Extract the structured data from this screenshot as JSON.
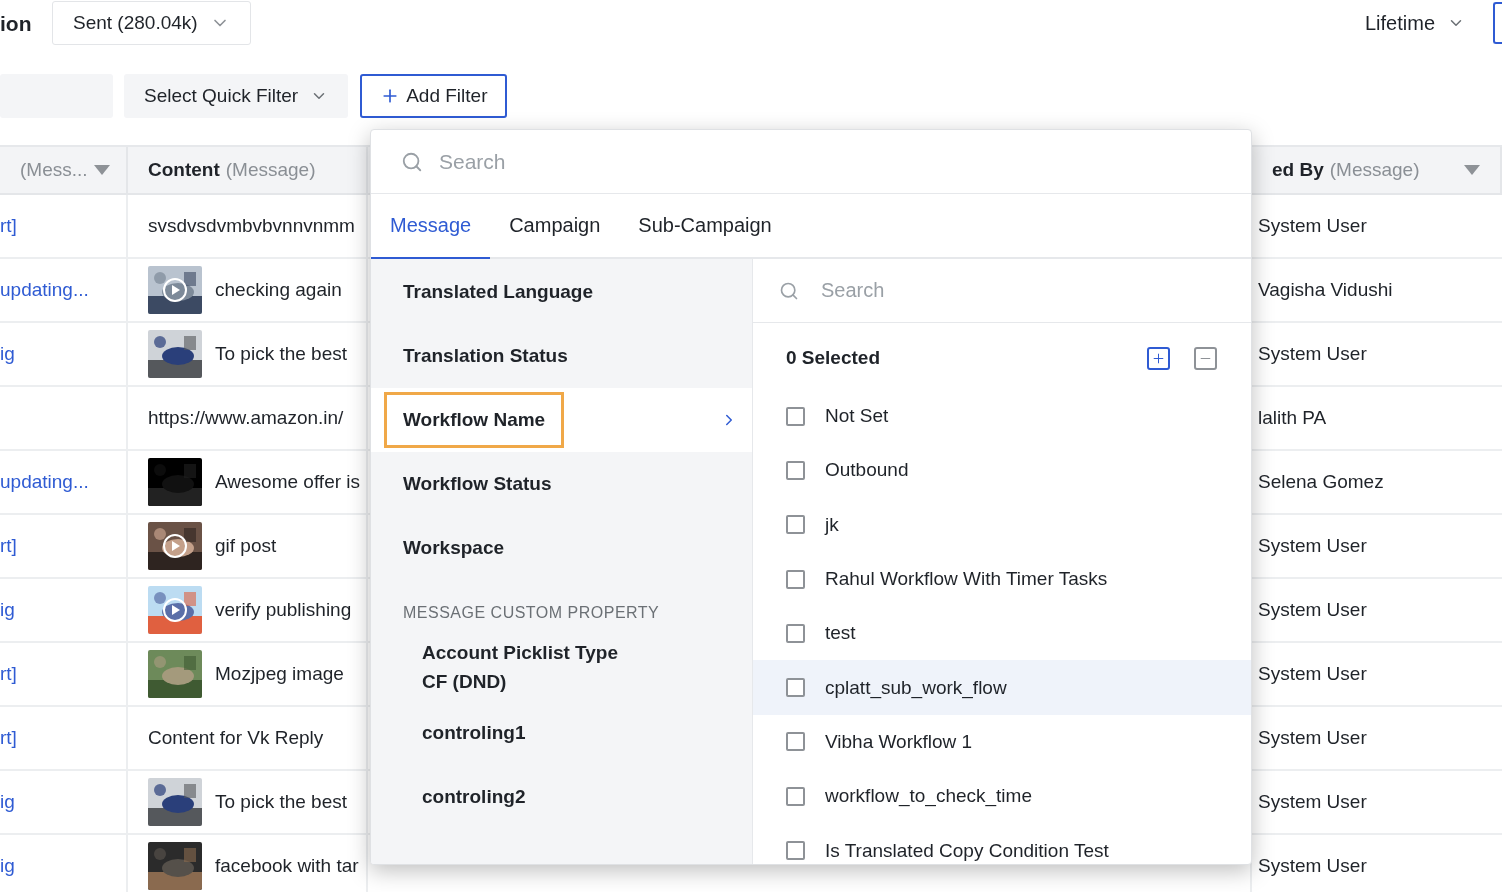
{
  "header": {
    "title": "ion",
    "status_dropdown": "Sent (280.04k)",
    "range_dropdown": "Lifetime"
  },
  "filter_bar": {
    "quick_filter": "Select Quick Filter",
    "add_filter": "Add Filter"
  },
  "table": {
    "columns": [
      {
        "source": "(Mess...",
        "menu": true
      },
      {
        "name": "Content",
        "source": "(Message)",
        "menu": false
      },
      {
        "name": "ed By",
        "source": "(Message)",
        "menu": true
      }
    ],
    "rows": [
      {
        "column_1": "rt]",
        "content": "svsdvsdvmbvbvnnvnmm",
        "by": "System User"
      },
      {
        "column_1": "updating...",
        "content": "checking again",
        "thumbnail": {
          "kind": "picture",
          "video": true
        },
        "by": "Vagisha Vidushi"
      },
      {
        "column_1": "ig",
        "content": "To pick the best",
        "thumbnail": {
          "kind": "picture",
          "video": false
        },
        "by": "System User"
      },
      {
        "content": "https://www.amazon.in/",
        "by": "lalith PA"
      },
      {
        "column_1": "updating...",
        "content": "Awesome offer is",
        "thumbnail": {
          "kind": "picture",
          "video": false
        },
        "by": "Selena Gomez"
      },
      {
        "column_1": "rt]",
        "content": "gif post",
        "thumbnail": {
          "kind": "picture",
          "video": true
        },
        "by": "System User"
      },
      {
        "column_1": "ig",
        "content": "verify publishing",
        "thumbnail": {
          "kind": "picture",
          "video": true
        },
        "by": "System User"
      },
      {
        "column_1": "rt]",
        "content": "Mozjpeg image",
        "thumbnail": {
          "kind": "picture",
          "video": false
        },
        "by": "System User"
      },
      {
        "column_1": "rt]",
        "content": "Content for Vk Reply",
        "by": "System User"
      },
      {
        "column_1": "ig",
        "content": "To pick the best",
        "thumbnail": {
          "kind": "picture",
          "video": false
        },
        "by": "System User"
      },
      {
        "column_1": "ig",
        "content": "facebook with tar",
        "thumbnail": {
          "kind": "picture",
          "video": false
        },
        "by": "System User"
      }
    ]
  },
  "filter_menu": {
    "search": {
      "placeholder": "Search"
    },
    "tabs": [
      {
        "label": "Message",
        "selected": true
      },
      {
        "label": "Campaign",
        "selected": false
      },
      {
        "label": "Sub-Campaign",
        "selected": false
      }
    ],
    "fields": [
      {
        "label": "Translated Language",
        "selected": false
      },
      {
        "label": "Translation Status",
        "selected": false
      },
      {
        "label": "Workflow Name",
        "selected": true
      },
      {
        "label": "Workflow Status",
        "selected": false
      },
      {
        "label": "Workspace",
        "selected": false
      }
    ],
    "custom_section": {
      "title": "MESSAGE CUSTOM PROPERTY",
      "fields": [
        {
          "label": "Account Picklist Type CF (DND)",
          "selected": false
        },
        {
          "label": "controling1",
          "selected": false
        },
        {
          "label": "controling2",
          "selected": false
        }
      ]
    },
    "values": {
      "search": {
        "placeholder": "Search"
      },
      "count": "0 Selected",
      "options": [
        {
          "label": "Not Set",
          "checked": false,
          "hovered": false
        },
        {
          "label": "Outbound",
          "checked": false,
          "hovered": false
        },
        {
          "label": "jk",
          "checked": false,
          "hovered": false
        },
        {
          "label": "Rahul Workflow With Timer Tasks",
          "checked": false,
          "hovered": false
        },
        {
          "label": "test",
          "checked": false,
          "hovered": false
        },
        {
          "label": "cplatt_sub_work_flow",
          "checked": false,
          "hovered": true
        },
        {
          "label": "Vibha Workflow 1",
          "checked": false,
          "hovered": false
        },
        {
          "label": "workflow_to_check_time",
          "checked": false,
          "hovered": false
        },
        {
          "label": "Is Translated Copy Condition Test",
          "checked": false,
          "hovered": false
        }
      ]
    }
  }
}
